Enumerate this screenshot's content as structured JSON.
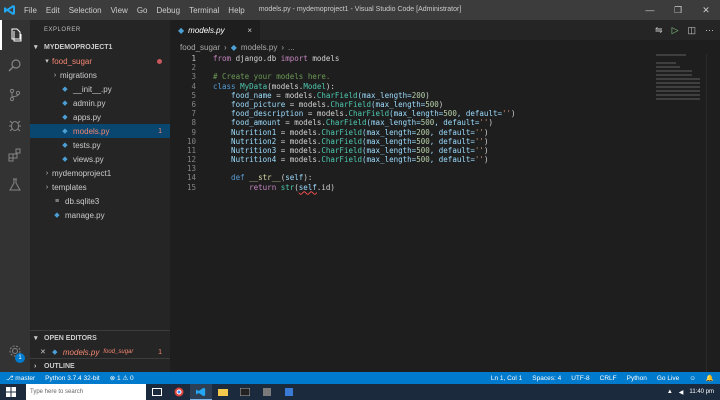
{
  "window": {
    "title": "models.py - mydemoproject1 - Visual Studio Code [Administrator]",
    "menu": [
      "File",
      "Edit",
      "Selection",
      "View",
      "Go",
      "Debug",
      "Terminal",
      "Help"
    ],
    "controls": [
      "—",
      "❐",
      "✕"
    ]
  },
  "sidebar": {
    "header": "EXPLORER",
    "project": "MYDEMOPROJECT1",
    "items": [
      {
        "label": "food_sugar",
        "kind": "folder-open",
        "indent": 1,
        "status": "error-dot"
      },
      {
        "label": "migrations",
        "kind": "folder",
        "indent": 2
      },
      {
        "label": "__init__.py",
        "kind": "py",
        "indent": 2
      },
      {
        "label": "admin.py",
        "kind": "py",
        "indent": 2
      },
      {
        "label": "apps.py",
        "kind": "py",
        "indent": 2
      },
      {
        "label": "models.py",
        "kind": "py",
        "indent": 2,
        "selected": true,
        "count": "1"
      },
      {
        "label": "tests.py",
        "kind": "py",
        "indent": 2
      },
      {
        "label": "views.py",
        "kind": "py",
        "indent": 2
      },
      {
        "label": "mydemoproject1",
        "kind": "folder",
        "indent": 1
      },
      {
        "label": "templates",
        "kind": "folder",
        "indent": 1
      },
      {
        "label": "db.sqlite3",
        "kind": "db",
        "indent": 1
      },
      {
        "label": "manage.py",
        "kind": "py",
        "indent": 1
      }
    ],
    "open_editors": {
      "label": "OPEN EDITORS",
      "file": "models.py",
      "path": "food_sugar",
      "count": "1"
    },
    "outline": "OUTLINE"
  },
  "tab": {
    "label": "models.py",
    "close": "×"
  },
  "breadcrumb": [
    "food_sugar",
    "›",
    "models.py",
    "›",
    "..."
  ],
  "editor": {
    "lines": [
      {
        "n": "1",
        "parts": [
          {
            "t": "from",
            "c": "kw"
          },
          {
            "t": " django.db ",
            "c": ""
          },
          {
            "t": "import",
            "c": "kw"
          },
          {
            "t": " models",
            "c": ""
          }
        ]
      },
      {
        "n": "2",
        "parts": []
      },
      {
        "n": "3",
        "parts": [
          {
            "t": "# Create your models here.",
            "c": "cm"
          }
        ]
      },
      {
        "n": "4",
        "parts": [
          {
            "t": "class",
            "c": "kw2"
          },
          {
            "t": " ",
            "c": ""
          },
          {
            "t": "MyData",
            "c": "cls"
          },
          {
            "t": "(models.",
            "c": ""
          },
          {
            "t": "Model",
            "c": "cls"
          },
          {
            "t": "):",
            "c": ""
          }
        ]
      },
      {
        "n": "5",
        "parts": [
          {
            "t": "    food_name ",
            "c": "var"
          },
          {
            "t": "= models.",
            "c": ""
          },
          {
            "t": "CharField",
            "c": "cls"
          },
          {
            "t": "(max_length=",
            "c": "var"
          },
          {
            "t": "200",
            "c": "num"
          },
          {
            "t": ")",
            "c": ""
          }
        ]
      },
      {
        "n": "6",
        "parts": [
          {
            "t": "    food_picture ",
            "c": "var"
          },
          {
            "t": "= models.",
            "c": ""
          },
          {
            "t": "CharField",
            "c": "cls"
          },
          {
            "t": "(max_length=",
            "c": "var"
          },
          {
            "t": "500",
            "c": "num"
          },
          {
            "t": ")",
            "c": ""
          }
        ]
      },
      {
        "n": "7",
        "parts": [
          {
            "t": "    food_description ",
            "c": "var"
          },
          {
            "t": "= models.",
            "c": ""
          },
          {
            "t": "CharField",
            "c": "cls"
          },
          {
            "t": "(max_length=",
            "c": "var"
          },
          {
            "t": "500",
            "c": "num"
          },
          {
            "t": ", default=",
            "c": "var"
          },
          {
            "t": "''",
            "c": "str"
          },
          {
            "t": ")",
            "c": ""
          }
        ]
      },
      {
        "n": "8",
        "parts": [
          {
            "t": "    food_amount ",
            "c": "var"
          },
          {
            "t": "= models.",
            "c": ""
          },
          {
            "t": "CharField",
            "c": "cls"
          },
          {
            "t": "(max_length=",
            "c": "var"
          },
          {
            "t": "500",
            "c": "num"
          },
          {
            "t": ", default=",
            "c": "var"
          },
          {
            "t": "''",
            "c": "str"
          },
          {
            "t": ")",
            "c": ""
          }
        ]
      },
      {
        "n": "9",
        "parts": [
          {
            "t": "    Nutrition1 ",
            "c": "var"
          },
          {
            "t": "= models.",
            "c": ""
          },
          {
            "t": "CharField",
            "c": "cls"
          },
          {
            "t": "(max_length=",
            "c": "var"
          },
          {
            "t": "200",
            "c": "num"
          },
          {
            "t": ", default=",
            "c": "var"
          },
          {
            "t": "''",
            "c": "str"
          },
          {
            "t": ")",
            "c": ""
          }
        ]
      },
      {
        "n": "10",
        "parts": [
          {
            "t": "    Nutrition2 ",
            "c": "var"
          },
          {
            "t": "= models.",
            "c": ""
          },
          {
            "t": "CharField",
            "c": "cls"
          },
          {
            "t": "(max_length=",
            "c": "var"
          },
          {
            "t": "500",
            "c": "num"
          },
          {
            "t": ", default=",
            "c": "var"
          },
          {
            "t": "''",
            "c": "str"
          },
          {
            "t": ")",
            "c": ""
          }
        ]
      },
      {
        "n": "11",
        "parts": [
          {
            "t": "    Nutrition3 ",
            "c": "var"
          },
          {
            "t": "= models.",
            "c": ""
          },
          {
            "t": "CharField",
            "c": "cls"
          },
          {
            "t": "(max_length=",
            "c": "var"
          },
          {
            "t": "500",
            "c": "num"
          },
          {
            "t": ", default=",
            "c": "var"
          },
          {
            "t": "''",
            "c": "str"
          },
          {
            "t": ")",
            "c": ""
          }
        ]
      },
      {
        "n": "12",
        "parts": [
          {
            "t": "    Nutrition4 ",
            "c": "var"
          },
          {
            "t": "= models.",
            "c": ""
          },
          {
            "t": "CharField",
            "c": "cls"
          },
          {
            "t": "(max_length=",
            "c": "var"
          },
          {
            "t": "500",
            "c": "num"
          },
          {
            "t": ", default=",
            "c": "var"
          },
          {
            "t": "''",
            "c": "str"
          },
          {
            "t": ")",
            "c": ""
          }
        ]
      },
      {
        "n": "13",
        "parts": []
      },
      {
        "n": "14",
        "parts": [
          {
            "t": "    def",
            "c": "kw2"
          },
          {
            "t": " ",
            "c": ""
          },
          {
            "t": "__str__",
            "c": "fn"
          },
          {
            "t": "(",
            "c": ""
          },
          {
            "t": "self",
            "c": "var"
          },
          {
            "t": "):",
            "c": ""
          }
        ]
      },
      {
        "n": "15",
        "parts": [
          {
            "t": "        return",
            "c": "kw"
          },
          {
            "t": " ",
            "c": ""
          },
          {
            "t": "str",
            "c": "cls"
          },
          {
            "t": "(",
            "c": ""
          },
          {
            "t": "self",
            "c": "var squig"
          },
          {
            "t": ".id)",
            "c": ""
          }
        ]
      }
    ]
  },
  "statusbar": {
    "left": [
      "master",
      "Python 3.7.4 32-bit",
      "⊗ 1 ⚠ 0"
    ],
    "right": [
      "Ln 1, Col 1",
      "Spaces: 4",
      "UTF-8",
      "CRLF",
      "Python",
      "Go Live",
      "☺",
      "🔔"
    ]
  },
  "taskbar": {
    "search_placeholder": "Type here to search",
    "clock": "11:40 pm"
  },
  "colors": {
    "accent": "#007acc",
    "selection": "#094771",
    "error": "#f48771"
  }
}
